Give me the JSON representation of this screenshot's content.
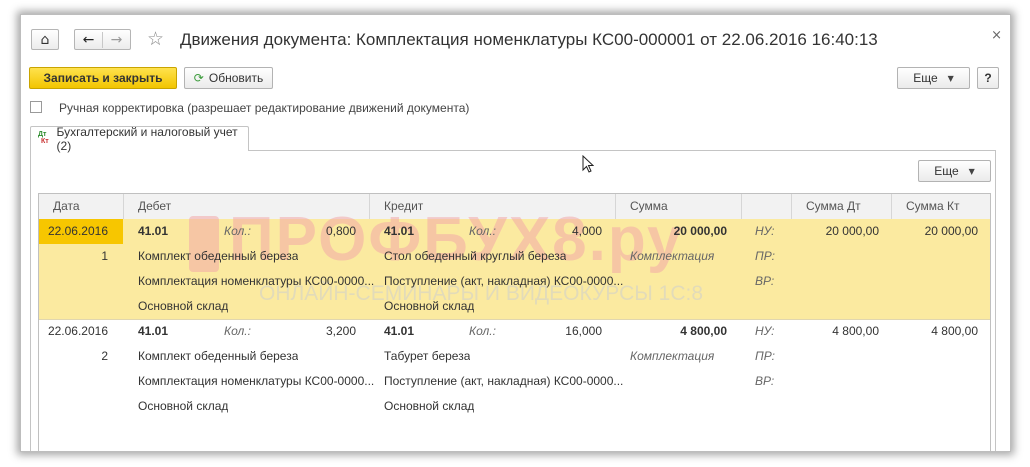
{
  "window": {
    "title": "Движения документа: Комплектация номенклатуры КС00-000001 от 22.06.2016 16:40:13",
    "close_glyph": "×"
  },
  "nav": {
    "home_glyph": "⌂",
    "back_glyph": "←",
    "forward_glyph": "→",
    "star_glyph": "☆"
  },
  "toolbar": {
    "save_close_label": "Записать и закрыть",
    "refresh_label": "Обновить",
    "more_label": "Еще",
    "help_label": "?"
  },
  "manual_edit": {
    "label": "Ручная корректировка (разрешает редактирование движений документа)",
    "checked": false
  },
  "tab": {
    "label": "Бухгалтерский и налоговый учет (2)",
    "icon": "accounting-dt-kt-icon",
    "icon_top": "Дт",
    "icon_bottom": "Кт"
  },
  "table_toolbar": {
    "more_label": "Еще"
  },
  "watermark": {
    "big": "ПРОФБУХ8.ру",
    "small": "ОНЛАЙН-СЕМИНАРЫ И ВИДЕОКУРСЫ 1С:8"
  },
  "columns": [
    "Дата",
    "Дебет",
    "Кредит",
    "Сумма",
    "Сумма Дт",
    "Сумма Кт"
  ],
  "rows": [
    {
      "date": "22.06.2016",
      "num": "1",
      "debit_account": "41.01",
      "debit_qty_label": "Кол.:",
      "debit_qty": "0,800",
      "debit_sub1": "Комплект обеденный береза",
      "debit_sub2": "Комплектация номенклатуры КС00-0000...",
      "debit_sub3": "Основной склад",
      "credit_account": "41.01",
      "credit_qty_label": "Кол.:",
      "credit_qty": "4,000",
      "credit_sub1": "Стол обеденный круглый береза",
      "credit_sub2": "Поступление (акт, накладная) КС00-0000...",
      "credit_sub3": "Основной склад",
      "sum": "20 000,00",
      "content": "Комплектация",
      "nu_label": "НУ:",
      "pr_label": "ПР:",
      "vr_label": "ВР:",
      "sum_dt": "20 000,00",
      "sum_kt": "20 000,00",
      "selected": true
    },
    {
      "date": "22.06.2016",
      "num": "2",
      "debit_account": "41.01",
      "debit_qty_label": "Кол.:",
      "debit_qty": "3,200",
      "debit_sub1": "Комплект обеденный береза",
      "debit_sub2": "Комплектация номенклатуры КС00-0000...",
      "debit_sub3": "Основной склад",
      "credit_account": "41.01",
      "credit_qty_label": "Кол.:",
      "credit_qty": "16,000",
      "credit_sub1": "Табурет береза",
      "credit_sub2": "Поступление (акт, накладная) КС00-0000...",
      "credit_sub3": "Основной склад",
      "sum": "4 800,00",
      "content": "Комплектация",
      "nu_label": "НУ:",
      "pr_label": "ПР:",
      "vr_label": "ВР:",
      "sum_dt": "4 800,00",
      "sum_kt": "4 800,00",
      "selected": false
    }
  ],
  "colors": {
    "accent_yellow": "#f2c500",
    "row_highlight": "#fbeaa0",
    "selected_cell": "#f7c600"
  }
}
